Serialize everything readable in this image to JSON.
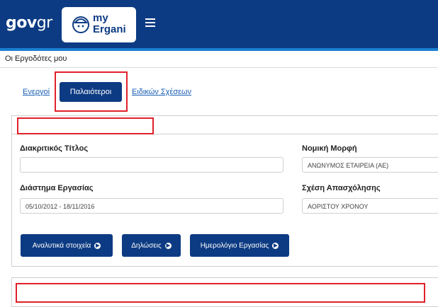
{
  "header": {
    "gov_logo_main": "gov",
    "gov_logo_suffix": "gr",
    "app_logo_line1": "my",
    "app_logo_line2": "Ergani"
  },
  "breadcrumb": "Οι Εργοδότες μου",
  "tabs": [
    {
      "label": "Ενεργοί",
      "active": false
    },
    {
      "label": "Παλαιότεροι",
      "active": true
    },
    {
      "label": "Ειδικών Σχέσεων",
      "active": false
    }
  ],
  "employer": {
    "title_label": "Διακριτικός Τίτλος",
    "title_value": "",
    "legal_form_label": "Νομική Μορφή",
    "legal_form_value": "ΑΝΩΝΥΜΟΣ ΕΤΑΙΡΕΙΑ (ΑΕ)",
    "period_label": "Διάστημα Εργασίας",
    "period_value": "05/10/2012 - 18/11/2016",
    "relation_label": "Σχέση Απασχόλησης",
    "relation_value": "ΑΟΡΙΣΤΟΥ ΧΡΟΝΟΥ"
  },
  "buttons": {
    "details": "Αναλυτικά στοιχεία",
    "declarations": "Δηλώσεις",
    "calendar": "Ημερολόγιο Εργασίας"
  },
  "colors": {
    "primary": "#0d3b83",
    "accent": "#1a7fd0",
    "highlight": "#e0212b"
  }
}
